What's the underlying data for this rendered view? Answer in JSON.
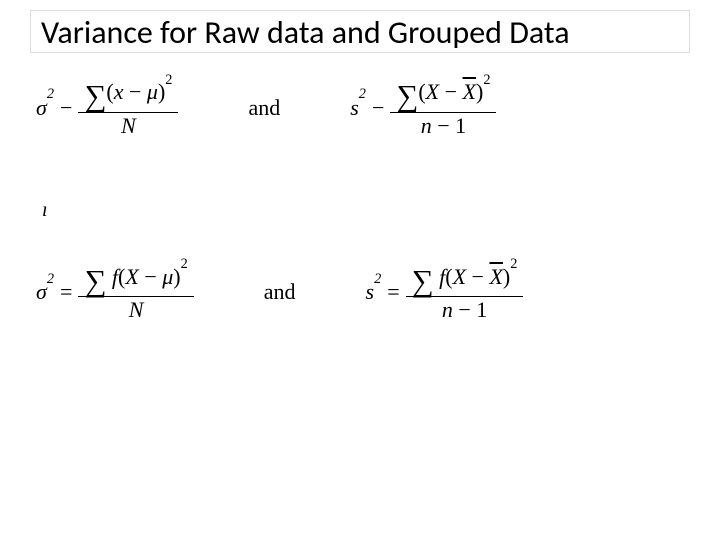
{
  "title": "Variance for Raw data and Grouped Data",
  "connector": "and",
  "stray_char": "ı",
  "symbols": {
    "sigma_sq": "σ",
    "s_sq": "s",
    "sq": "2",
    "sum": "∑",
    "mu": "μ",
    "X_upper": "X",
    "x_lower": "x",
    "Xbar": "X",
    "f": "f",
    "N_upper": "N",
    "n_lower": "n",
    "minus_one": "− 1",
    "minus": "−",
    "equals": "=",
    "lp": "(",
    "rp": ")"
  }
}
